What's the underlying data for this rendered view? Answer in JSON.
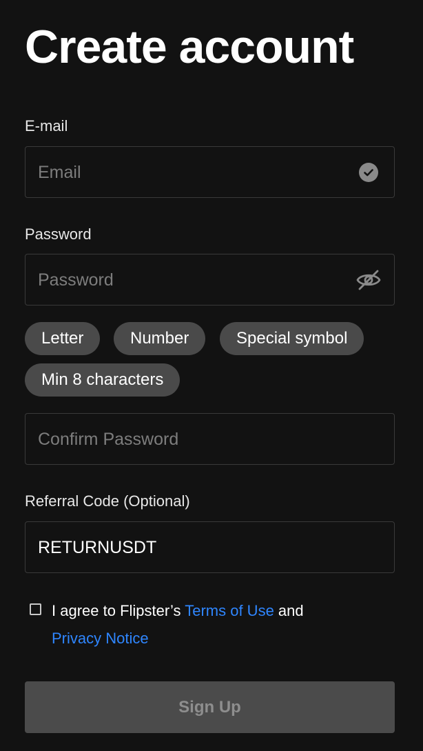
{
  "header": {
    "title": "Create account"
  },
  "email": {
    "label": "E-mail",
    "placeholder": "Email",
    "icon": "check-circle-icon"
  },
  "password": {
    "label": "Password",
    "placeholder": "Password",
    "icon": "eye-off-icon"
  },
  "password_rules": [
    "Letter",
    "Number",
    "Special symbol",
    "Min 8 characters"
  ],
  "confirm_password": {
    "placeholder": "Confirm Password"
  },
  "referral": {
    "label": "Referral Code (Optional)",
    "value": "RETURNUSDT"
  },
  "agreement": {
    "prefix": "I agree to Flipster’s ",
    "terms_link": "Terms of Use",
    "middle": " and",
    "privacy_link": "Privacy Notice",
    "checked": false
  },
  "signup_button": {
    "label": "Sign Up"
  },
  "colors": {
    "background": "#121212",
    "link": "#2f86ff",
    "chip": "#4a4a4a",
    "button_disabled": "#4b4b4b"
  }
}
